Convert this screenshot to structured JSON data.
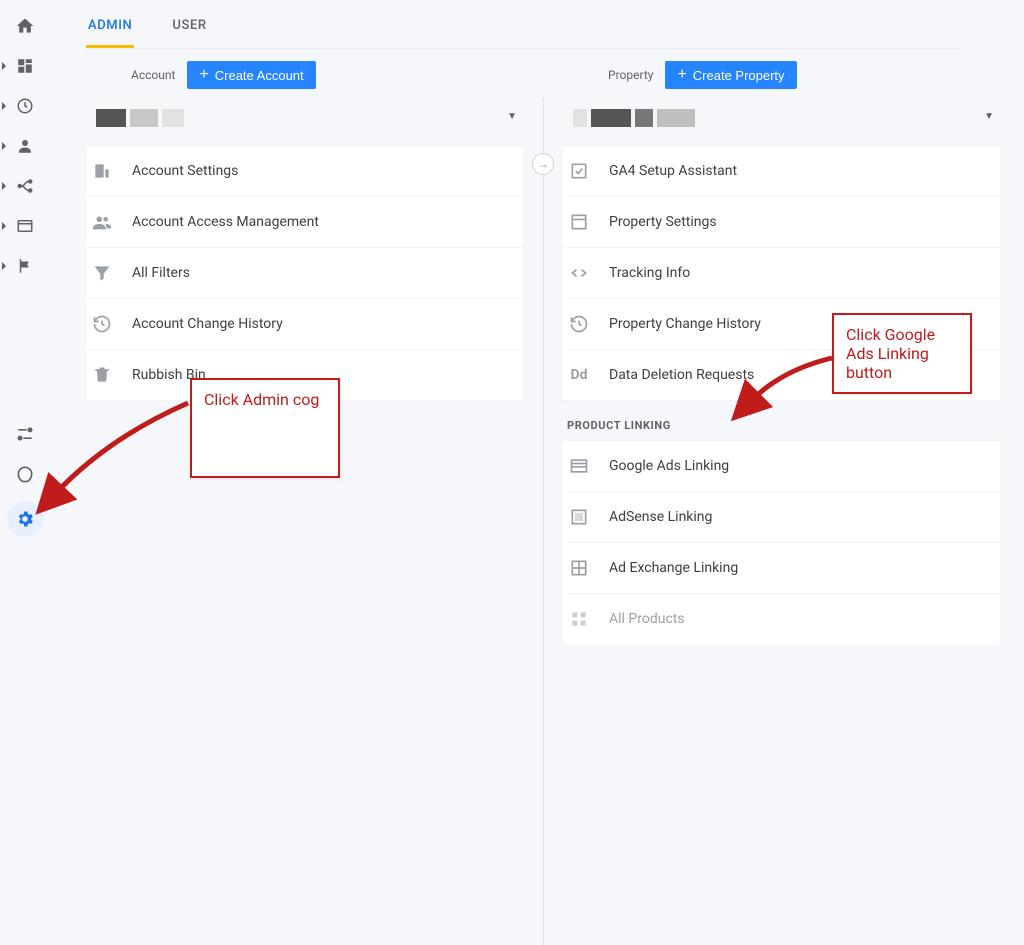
{
  "tabs": {
    "admin": "ADMIN",
    "user": "USER"
  },
  "account": {
    "label": "Account",
    "create": "Create Account",
    "items": [
      "Account Settings",
      "Account Access Management",
      "All Filters",
      "Account Change History",
      "Rubbish Bin"
    ]
  },
  "property": {
    "label": "Property",
    "create": "Create Property",
    "items": [
      "GA4 Setup Assistant",
      "Property Settings",
      "Tracking Info",
      "Property Change History",
      "Data Deletion Requests"
    ],
    "section": "PRODUCT LINKING",
    "linking": [
      "Google Ads Linking",
      "AdSense Linking",
      "Ad Exchange Linking",
      "All Products"
    ]
  },
  "anno": {
    "cog": "Click Admin cog",
    "ads": "Click Google Ads Linking button"
  },
  "colors": {
    "accent": "#1a73e8",
    "tab_underline": "#fbbc04",
    "button": "#2684ff",
    "anno": "#c01c1c"
  }
}
